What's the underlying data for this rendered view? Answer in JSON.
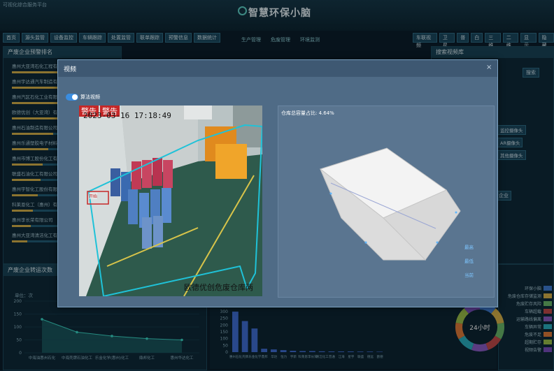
{
  "header": {
    "title": "智慧环保小脑",
    "corner_note": "可视化综合服务平台"
  },
  "menu": [
    "首页",
    "源头监管",
    "设备监控",
    "车辆跟踪",
    "处置监管",
    "联单跟踪",
    "预警信息",
    "数据统计"
  ],
  "right_menu": [
    "车联视频",
    "卫星",
    "普",
    "白",
    "三维",
    "二维",
    "显示",
    "隐藏"
  ],
  "center_tabs": [
    "生产管理",
    "危废管理",
    "环境监测"
  ],
  "left_panel": {
    "title": "产废企业预警排名",
    "items": [
      {
        "name": "惠州大亚湾石化工程有限公司",
        "level": 0.7
      },
      {
        "name": "惠州宇达通汽车制造有限公司",
        "level": 0.6
      },
      {
        "name": "惠州汽区石化工业有限公司",
        "level": 0.5
      },
      {
        "name": "欧德优创（大亚湾）有限公司",
        "level": 0.45
      },
      {
        "name": "惠州石油制造有限公司",
        "level": 0.4
      },
      {
        "name": "惠州乐通塑胶电子材料有限公司",
        "level": 0.35
      },
      {
        "name": "惠州市博工股份化工有限公司",
        "level": 0.3
      },
      {
        "name": "联盛石油化工有限公司",
        "level": 0.28
      },
      {
        "name": "惠州宇智化工股份有限公司",
        "level": 0.25
      },
      {
        "name": "科莱恩化工（惠州）有限公司",
        "level": 0.2
      },
      {
        "name": "惠州李长荣有限公司",
        "level": 0.18
      },
      {
        "name": "惠州大亚湾清洁化工有限公司",
        "level": 0.15
      }
    ]
  },
  "left_panel2": {
    "title": "产废企业转运次数",
    "unit_label": "单位：次",
    "y_ticks": [
      "200",
      "150",
      "100",
      "50",
      "0"
    ],
    "x_labels": [
      "中海油惠州石化",
      "中海壳牌石油化工",
      "乐金化学(惠州)化工",
      "鼎邦化工",
      "惠州华达化工"
    ],
    "values": [
      130,
      80,
      65,
      55,
      50
    ]
  },
  "right_panel": {
    "title": "搜索视频库",
    "search_label": "搜索",
    "cameras": [
      "监控摄像头",
      "AR摄像头",
      "其他摄像头"
    ],
    "tag": "企业"
  },
  "right_panel2": {
    "center_text": "24小时",
    "legend": [
      {
        "label": "环保小脑",
        "color": "#3f7fd6"
      },
      {
        "label": "危废仓库存储监测",
        "color": "#d7b24a"
      },
      {
        "label": "危废贮存风险",
        "color": "#6bb86a"
      },
      {
        "label": "车辆超载",
        "color": "#c24a4a"
      },
      {
        "label": "运输路线偏离",
        "color": "#8b5cc7"
      },
      {
        "label": "车辆异常",
        "color": "#2ab0c0"
      },
      {
        "label": "危废不足",
        "color": "#e07b39"
      },
      {
        "label": "超期贮存",
        "color": "#9bc04a"
      },
      {
        "label": "视频告警",
        "color": "#7a4fbf"
      }
    ]
  },
  "mid_chart": {
    "y_ticks": [
      "300",
      "250",
      "200",
      "150",
      "100",
      "50",
      "0"
    ],
    "values": [
      300,
      230,
      175,
      25,
      20,
      15,
      10,
      8,
      8,
      6,
      5,
      5,
      5,
      4,
      4,
      3
    ],
    "x_labels": [
      "惠州石化",
      "壳牌",
      "乐金化学",
      "鼎邦",
      "华达",
      "恒力",
      "宇新",
      "科莱恩",
      "李长荣",
      "清洁化工",
      "普通",
      "江海",
      "星宇",
      "联盛",
      "德远",
      "欧德"
    ]
  },
  "modal": {
    "title": "视频",
    "close_label": "×",
    "toggle_label": "算法视频",
    "video": {
      "alarm_tags": [
        "警告",
        "警告"
      ],
      "timestamp": "2023-03-16 17:18:49",
      "small_tag": "开始",
      "caption": "欧德优创危废仓库两"
    },
    "view3d": {
      "occupancy_label": "仓库总容量占比: 4.64%",
      "legend": [
        "最高",
        "最低",
        "当前"
      ]
    }
  },
  "colors": {
    "accent": "#3a8de0",
    "detection_outline": "#1fc2d8",
    "alarm": "#c62828"
  }
}
